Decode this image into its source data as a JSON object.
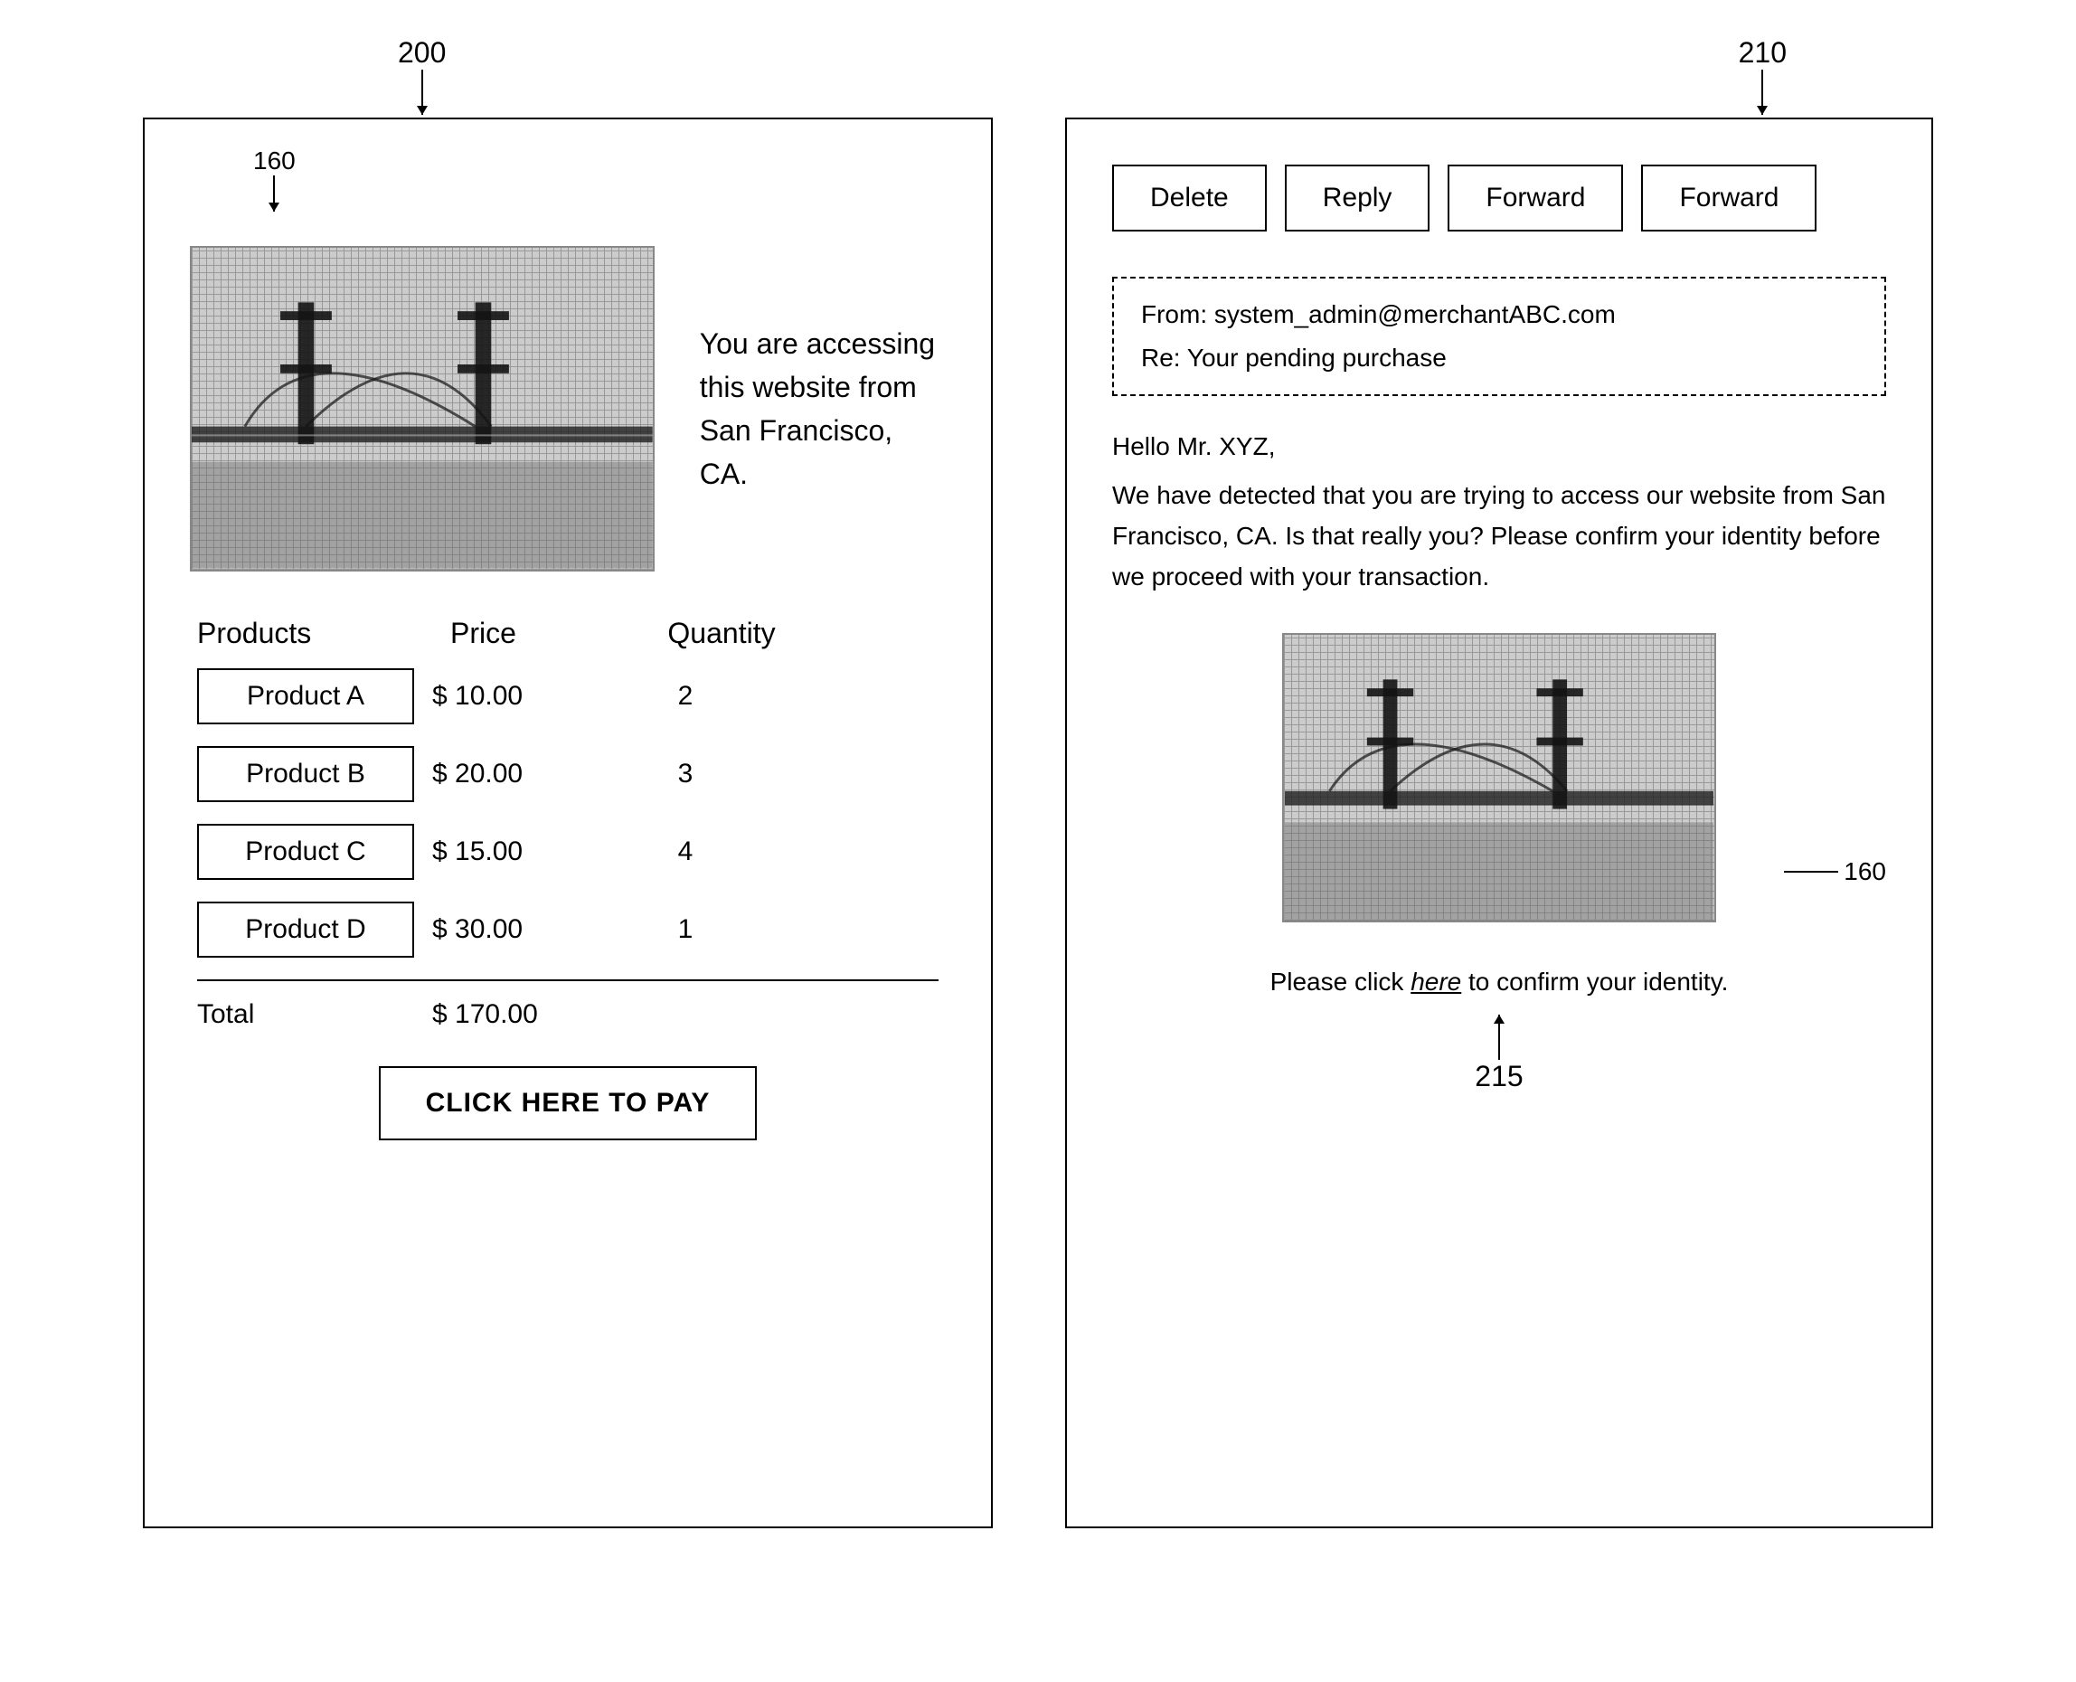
{
  "annotations": {
    "label_200": "200",
    "label_210": "210",
    "label_160a": "160",
    "label_160b": "160",
    "label_215": "215"
  },
  "left_panel": {
    "location_text": "You are accessing\nthis website from\nSan Francisco, CA.",
    "table": {
      "headers": {
        "products": "Products",
        "price": "Price",
        "quantity": "Quantity"
      },
      "rows": [
        {
          "name": "Product A",
          "price": "$ 10.00",
          "qty": "2"
        },
        {
          "name": "Product B",
          "price": "$ 20.00",
          "qty": "3"
        },
        {
          "name": "Product C",
          "price": "$ 15.00",
          "qty": "4"
        },
        {
          "name": "Product D",
          "price": "$ 30.00",
          "qty": "1"
        }
      ],
      "total_label": "Total",
      "total_amount": "$ 170.00"
    },
    "pay_button": "CLICK HERE TO PAY"
  },
  "right_panel": {
    "toolbar": {
      "delete": "Delete",
      "reply": "Reply",
      "forward1": "Forward",
      "forward2": "Forward"
    },
    "email_header": {
      "from": "From: system_admin@merchantABC.com",
      "subject": "Re: Your pending purchase"
    },
    "email_body": {
      "greeting": "Hello Mr. XYZ,",
      "content": "We have detected that you are trying to access our website from San Francisco, CA. Is that really you? Please confirm your identity before we proceed with your transaction."
    },
    "confirm_text_pre": "Please click ",
    "confirm_link": "here",
    "confirm_text_post": " to confirm your identity."
  }
}
